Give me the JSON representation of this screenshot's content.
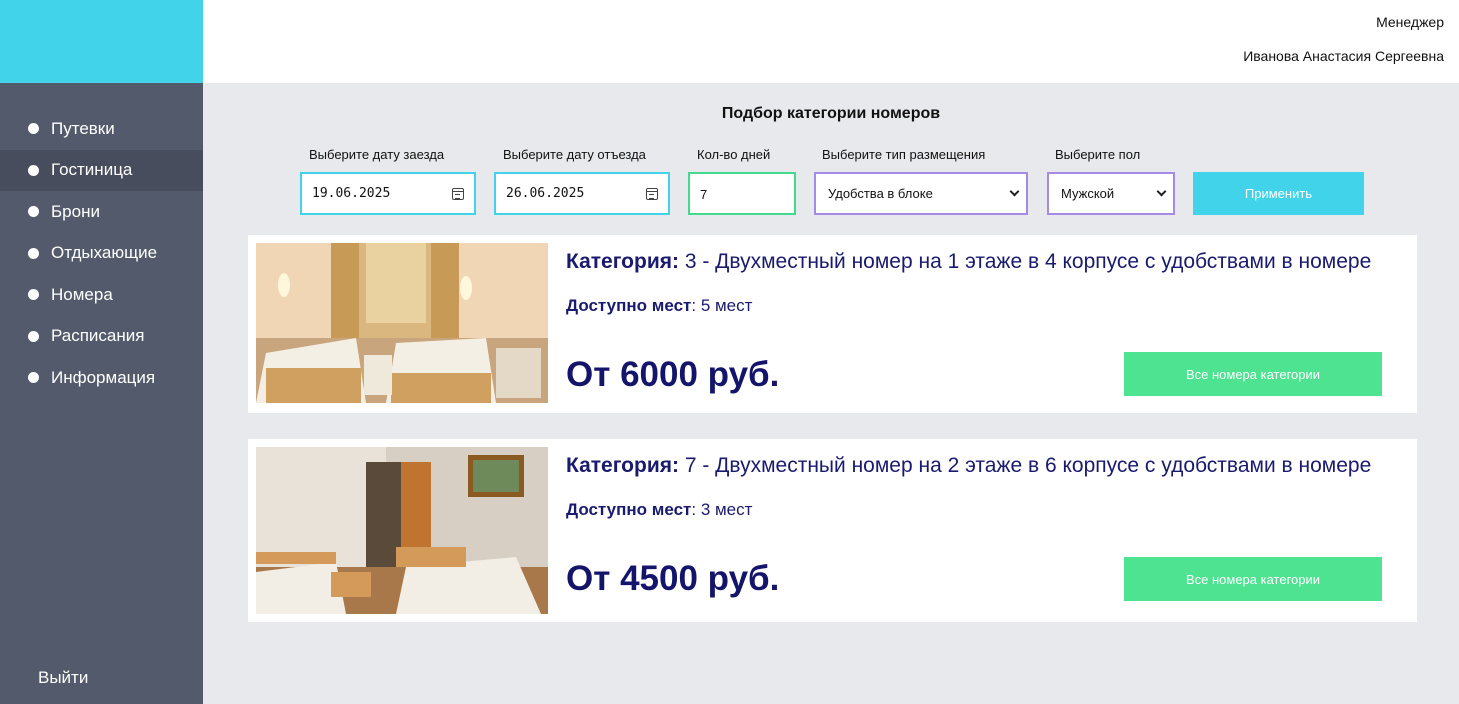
{
  "header": {
    "role": "Менеджер",
    "user_name": "Иванова Анастасия Сергеевна"
  },
  "sidebar": {
    "items": [
      {
        "label": "Путевки"
      },
      {
        "label": "Гостиница"
      },
      {
        "label": "Брони"
      },
      {
        "label": "Отдыхающие"
      },
      {
        "label": "Номера"
      },
      {
        "label": "Расписания"
      },
      {
        "label": "Информация"
      }
    ],
    "active_index": 1,
    "logout_label": "Выйти"
  },
  "filter": {
    "title": "Подбор категории номеров",
    "checkin_label": "Выберите дату заезда",
    "checkin_value": "19.06.2025",
    "checkout_label": "Выберите дату отъезда",
    "checkout_value": "26.06.2025",
    "days_label": "Кол-во дней",
    "days_value": "7",
    "placement_label": "Выберите тип размещения",
    "placement_value": "Удобства в блоке",
    "gender_label": "Выберите пол",
    "gender_value": "Мужской",
    "apply_label": "Применить"
  },
  "cards": [
    {
      "category_label": "Категория:",
      "category_text": " 3 - Двухместный номер на 1 этаже в 4 корпусе с удобствами в номере",
      "available_label": "Доступно мест",
      "available_text": ": 5 мест",
      "price": "От 6000 руб.",
      "button_label": "Все номера категории"
    },
    {
      "category_label": "Категория:",
      "category_text": " 7 - Двухместный номер на 2 этаже в 6 корпусе с удобствами в номере",
      "available_label": "Доступно мест",
      "available_text": ": 3 мест",
      "price": "От 4500 руб.",
      "button_label": "Все номера категории"
    }
  ],
  "colors": {
    "accent_cyan": "#40d3ea",
    "accent_green": "#4de391",
    "accent_purple": "#a58ae6",
    "sidebar": "#525a6b",
    "text_navy": "#14146a"
  }
}
